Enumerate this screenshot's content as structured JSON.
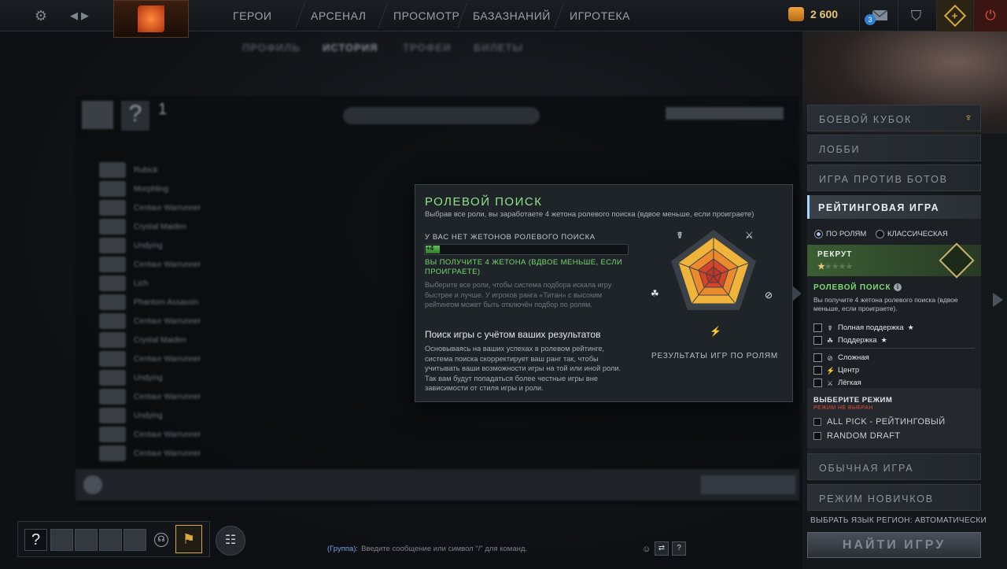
{
  "topnav": {
    "items": [
      "ГЕРОИ",
      "АРСЕНАЛ",
      "ПРОСМОТР",
      "БАЗАЗНАНИЙ",
      "ИГРОТЕКА"
    ],
    "coins": "2 600",
    "notif_count": "3"
  },
  "subtabs": [
    "ПРОФИЛЬ",
    "ИСТОРИЯ",
    "ТРОФЕИ",
    "БИЛЕТЫ"
  ],
  "history": {
    "count": "1",
    "rows": [
      "Rubick",
      "Morphling",
      "Centaur Warrunner",
      "Crystal Maiden",
      "Undying",
      "Centaur Warrunner",
      "Lich",
      "Phantom Assassin",
      "Centaur Warrunner",
      "Crystal Maiden",
      "Centaur Warrunner",
      "Undying",
      "Centaur Warrunner",
      "Undying",
      "Centaur Warrunner",
      "Centaur Warrunner"
    ]
  },
  "popup": {
    "title": "РОЛЕВОЙ ПОИСК",
    "subtitle": "Выбрав все роли, вы заработаете 4 жетона ролевого поиска (вдвое меньше, если проиграете)",
    "tokens_heading": "У ВАС НЕТ ЖЕТОНОВ РОЛЕВОГО ПОИСКА",
    "progress": 0.07,
    "progress_label": "+4",
    "green_note": "ВЫ ПОЛУЧИТЕ 4 ЖЕТОНА (ВДВОЕ МЕНЬШЕ, ЕСЛИ ПРОИГРАЕТЕ)",
    "muted_note": "Выберите все роли, чтобы система подбора искала игру быстрее и лучше. У игроков ранга «Титан» с высоким рейтингом может быть отключён подбор по ролям.",
    "section_title": "Поиск игры с учётом ваших результатов",
    "section_body": "Основываясь на ваших успехах в ролевом рейтинге, система поиска скорректирует ваш ранг так, чтобы учитывать ваши возможности игры на той или иной роли. Так вам будут попадаться более честные игры вне зависимости от стиля игры и роли.",
    "radar_caption": "РЕЗУЛЬТАТЫ ИГР ПО РОЛЯМ"
  },
  "right": {
    "menu_top": [
      "БОЕВОЙ КУБОК",
      "ЛОББИ",
      "ИГРА ПРОТИВ БОТОВ"
    ],
    "ranked_title": "РЕЙТИНГОВАЯ ИГРА",
    "radio_roles": "ПО РОЛЯМ",
    "radio_classic": "КЛАССИЧЕСКАЯ",
    "rank_name": "РЕКРУТ",
    "role_title": "РОЛЕВОЙ ПОИСК",
    "role_desc": "Вы получите 4 жетона ролевого поиска (вдвое меньше, если проиграете).",
    "roles": [
      "Полная поддержка",
      "Поддержка",
      "Сложная",
      "Центр",
      "Лёгкая"
    ],
    "mode_title": "ВЫБЕРИТЕ РЕЖИМ",
    "mode_warning": "РЕЖИМ НЕ ВЫБРАН",
    "modes": [
      "ALL PICK - РЕЙТИНГОВЫЙ",
      "RANDOM DRAFT"
    ],
    "menu_bottom": [
      "ОБЫЧНАЯ ИГРА",
      "РЕЖИМ НОВИЧКОВ"
    ],
    "lang": "ВЫБРАТЬ ЯЗЫК",
    "region": "РЕГИОН: АВТОМАТИЧЕСКИ",
    "find": "НАЙТИ ИГРУ"
  },
  "chat": {
    "group": "(Группа):",
    "placeholder": "Введите сообщение или символ \"/\" для команд."
  },
  "colors": {
    "accent_green": "#77d86e",
    "ranked_border": "#a6d8ff",
    "coins": "#e8c674"
  }
}
